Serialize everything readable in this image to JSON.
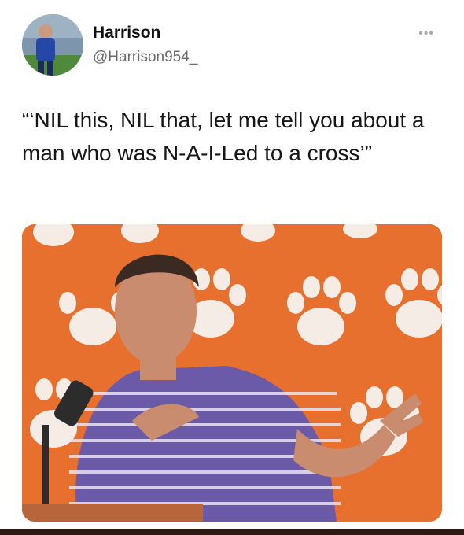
{
  "tweet": {
    "display_name": "Harrison",
    "handle": "@Harrison954_",
    "more_label": "•••",
    "text": "“‘NIL this, NIL that, let me tell you about a man who was N-A-I-Led to a cross’”"
  },
  "media": {
    "background_color": "#e8702f",
    "paw_color": "#f6f3f0",
    "shirt_color": "#6a5aa8"
  },
  "icons": {
    "more": "more-options-icon"
  }
}
